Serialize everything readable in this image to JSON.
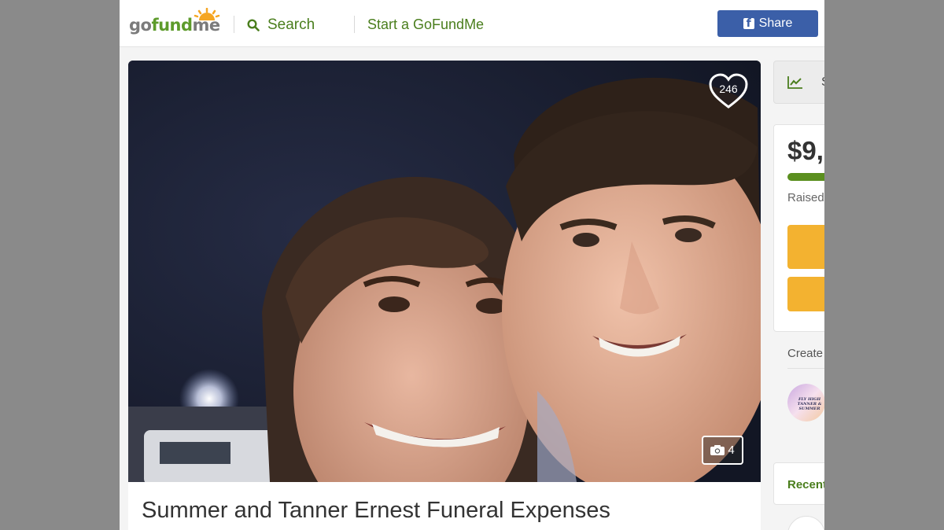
{
  "header": {
    "logo_go": "go",
    "logo_fund": "fund",
    "logo_me": "me",
    "search_label": "Search",
    "start_label": "Start a GoFundMe",
    "share_label": "Share"
  },
  "hero": {
    "heart_count": "246",
    "photo_count": "4"
  },
  "campaign": {
    "title": "Summer and Tanner Ernest Funeral Expenses"
  },
  "sidebar": {
    "stats_letter": "S",
    "amount_raised": "$9,",
    "raised_label": "Raised",
    "progress_fraction": 1.0,
    "created_label": "Create",
    "avatar_text": "FLY HIGH TANNER & SUMMER",
    "recent_label": "Recent"
  },
  "colors": {
    "brand_green": "#5d9b2b",
    "link_green": "#4a7e1d",
    "facebook_blue": "#3b5fa8",
    "donate_orange": "#f3b230",
    "progress_green": "#5b8f1f"
  },
  "icons": {
    "search": "search-icon",
    "facebook": "facebook-icon",
    "heart": "heart-icon",
    "camera": "camera-icon",
    "stats": "chart-trend-icon"
  }
}
